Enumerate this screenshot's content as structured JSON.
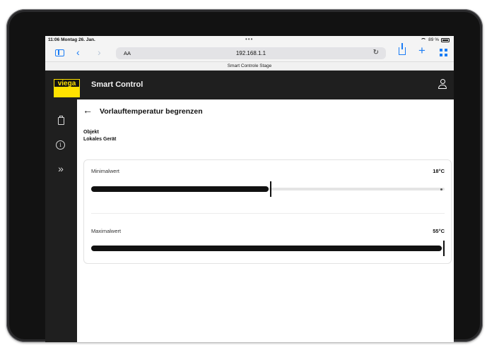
{
  "status_bar": {
    "time": "11:06",
    "date": "Montag 26. Jan.",
    "dots": "•••",
    "battery_text": "89 %"
  },
  "browser": {
    "text_size_button": "AA",
    "url": "192.168.1.1",
    "tab_title": "Smart Controle Stage"
  },
  "app": {
    "logo_text": "viega",
    "title": "Smart Control"
  },
  "page": {
    "title": "Vorlauftemperatur begrenzen",
    "object_label": "Objekt",
    "object_value": "Lokales Gerät"
  },
  "sliders": [
    {
      "label": "Minimalwert",
      "value": "18°C",
      "fraction": 0.51
    },
    {
      "label": "Maximalwert",
      "value": "55°C",
      "fraction": 1.0
    }
  ],
  "colors": {
    "brand_yellow": "#ffe200",
    "app_bar": "#1f1f1f",
    "safari_blue": "#1a7cf5"
  }
}
